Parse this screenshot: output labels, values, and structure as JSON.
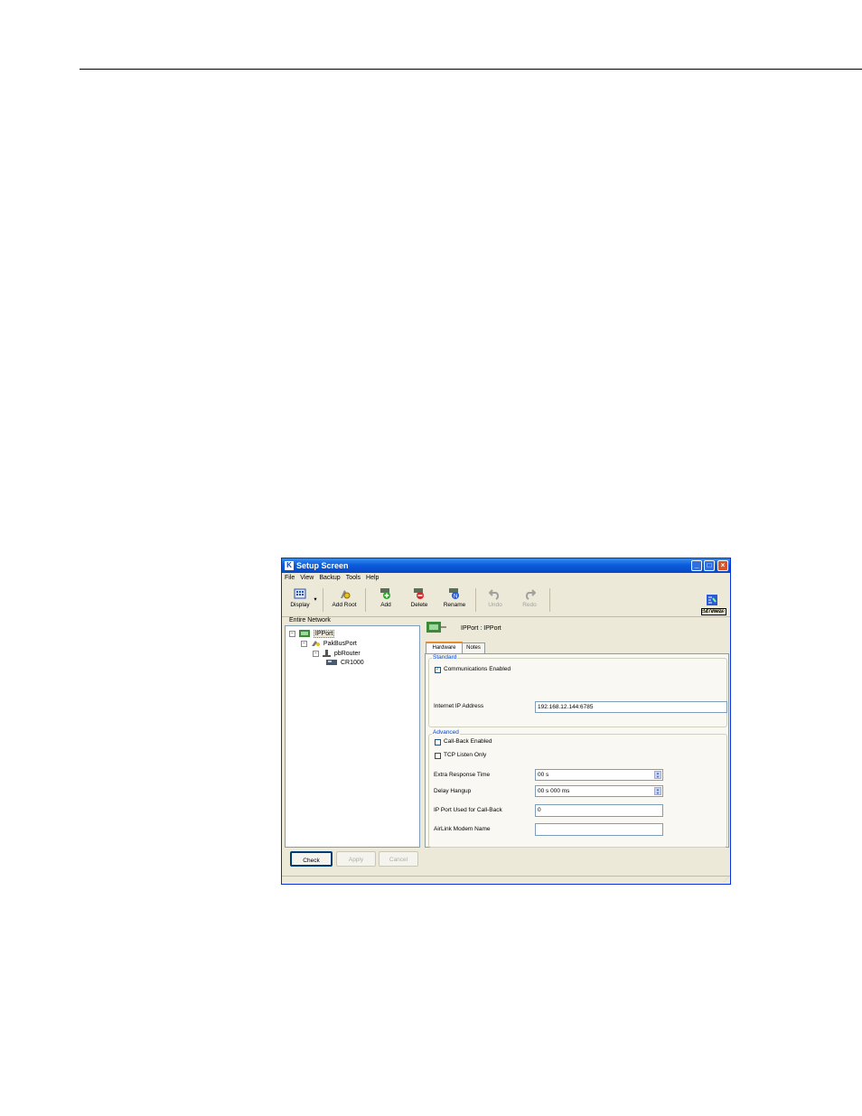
{
  "window": {
    "title": "Setup Screen",
    "app_icon_letter": "K",
    "tooltip": "Minimize"
  },
  "menu": [
    "File",
    "View",
    "Backup",
    "Tools",
    "Help"
  ],
  "toolbar": {
    "display": "Display",
    "add_root": "Add Root",
    "add": "Add",
    "delete": "Delete",
    "rename": "Rename",
    "undo": "Undo",
    "redo": "Redo",
    "ez_view": "EZ View"
  },
  "tree": {
    "header": "Entire Network",
    "nodes": [
      "IPPort",
      "PakBusPort",
      "pbRouter",
      "CR1000"
    ]
  },
  "bottom_buttons": {
    "check": "Check",
    "apply": "Apply",
    "cancel": "Cancel"
  },
  "device": {
    "label": "IPPort : IPPort"
  },
  "tabs": [
    "Hardware",
    "Notes"
  ],
  "standard": {
    "title": "Standard",
    "communications_enabled": "Communications Enabled",
    "internet_ip_label": "Internet IP Address",
    "internet_ip_value": "192.168.12.144:6785"
  },
  "advanced": {
    "title": "Advanced",
    "call_back": "Call-Back Enabled",
    "tcp_listen": "TCP Listen Only",
    "extra_response_label": "Extra Response Time",
    "extra_response_value": "00 s",
    "delay_hangup_label": "Delay Hangup",
    "delay_hangup_value": "00 s 000 ms",
    "ip_port_label": "IP Port Used for Call-Back",
    "ip_port_value": "0",
    "airlink_label": "AirLink Modem Name",
    "airlink_value": ""
  },
  "checkbox_states": {
    "communications_enabled": true,
    "call_back": false,
    "tcp_listen": false
  }
}
